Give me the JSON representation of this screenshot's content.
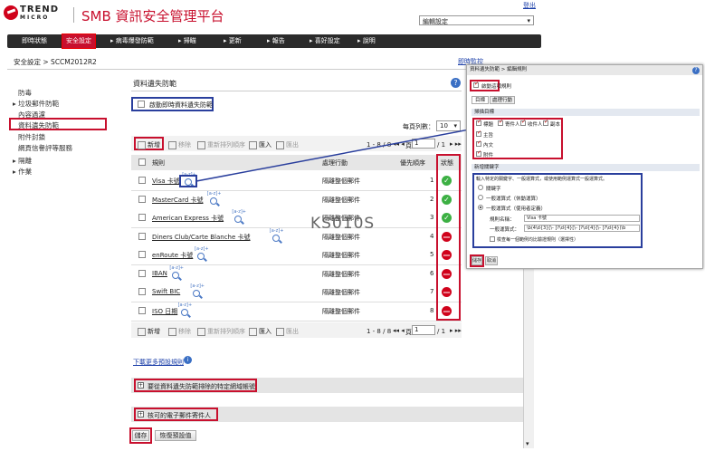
{
  "header": {
    "brand_line1": "TREND",
    "brand_line2": "MICRO",
    "title": "SMB 資訊安全管理平台",
    "logout": "登出",
    "edit_settings": "編輯設定"
  },
  "topnav": [
    "即時狀態",
    "安全設定",
    "▸ 病毒爆發防範",
    "▸ 掃瞄",
    "▸ 更新",
    "▸ 報告",
    "▸ 喜好設定",
    "▸ 說明"
  ],
  "breadcrumb": "安全設定 > SCCM2012R2",
  "realtime_monitor": "即時監控",
  "sidebar": [
    "防毒",
    "▸ 垃圾郵件防範",
    "內容過濾",
    "資料遺失防範",
    "附件封鎖",
    "網頁信譽評等服務",
    "▸ 隔離",
    "▸ 作業"
  ],
  "main": {
    "section_title": "資料遺失防範",
    "enable_label": "啟動即時資料遺失防範",
    "per_page_label": "每頁列數：",
    "per_page_value": "10",
    "toolbar": {
      "add": "新增",
      "remove": "移除",
      "reorder": "重新排列順序",
      "import": "匯入",
      "export": "匯出"
    },
    "pager": {
      "range": "1 - 8 / 8",
      "page_label": "頁",
      "page_value": "1",
      "total": "/ 1"
    },
    "columns": {
      "rule": "規則",
      "action": "處理行動",
      "priority": "優先順序",
      "status": "狀態"
    },
    "rows": [
      {
        "name": "Visa 卡號",
        "action": "隔離整個郵件",
        "priority": "1",
        "status": "enabled"
      },
      {
        "name": "MasterCard 卡號",
        "action": "隔離整個郵件",
        "priority": "2",
        "status": "enabled"
      },
      {
        "name": "American Express 卡號",
        "action": "隔離整個郵件",
        "priority": "3",
        "status": "enabled"
      },
      {
        "name": "Diners Club/Carte Blanche 卡號",
        "action": "隔離整個郵件",
        "priority": "4",
        "status": "disabled"
      },
      {
        "name": "enRoute 卡號",
        "action": "隔離整個郵件",
        "priority": "5",
        "status": "disabled"
      },
      {
        "name": "IBAN",
        "action": "隔離整個郵件",
        "priority": "6",
        "status": "disabled"
      },
      {
        "name": "Swift BIC",
        "action": "隔離整個郵件",
        "priority": "7",
        "status": "disabled"
      },
      {
        "name": "ISO 日期",
        "action": "隔離整個郵件",
        "priority": "8",
        "status": "disabled"
      }
    ],
    "regex_tag": "[a-z]+",
    "download_link": "下載更多預設規則",
    "collapse1": "要從資料遺失防範排除的特定網域帳號",
    "collapse2": "核可的電子郵件寄件人",
    "save": "儲存",
    "restore": "恢復預設值"
  },
  "watermark": "KS010S",
  "dialog": {
    "title": "資料遺失防範 > 編輯規則",
    "enable": "啟動這項規則",
    "tabs": [
      "目標",
      "處理行動"
    ],
    "scan_section": "掃描目標",
    "fields": [
      "標題",
      "寄件人",
      "收件人",
      "副本"
    ],
    "body_items": [
      "主旨",
      "內文",
      "附件"
    ],
    "keyword_section": "新增關鍵字",
    "keyword_hint": "輸入特定的關鍵字、一般運算式，或使用範例運算式一般運算式。",
    "opt1": "關鍵字",
    "opt2": "一般運算式（休動運算）",
    "opt3": "一般運算式（使用者定義）",
    "rule_name_label": "規則名稱：",
    "rule_name_value": "Visa 卡號",
    "regex_label": "一般運算式：",
    "regex_value": "\\b(4\\d{3}[\\- ]?\\d{4}[\\- ]?\\d{4}[\\- ]?\\d{4})\\b",
    "verify_label": "檢查每一個範例均比驗證規則（選擇性）",
    "save": "儲存",
    "cancel": "取消"
  }
}
